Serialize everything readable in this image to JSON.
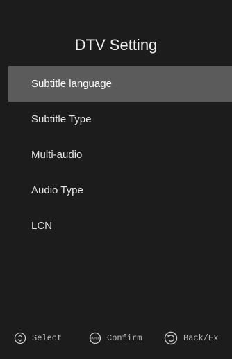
{
  "screen": {
    "title": "DTV Setting"
  },
  "menu": {
    "items": [
      {
        "label": "Subtitle language",
        "selected": true
      },
      {
        "label": "Subtitle Type",
        "selected": false
      },
      {
        "label": "Multi-audio",
        "selected": false
      },
      {
        "label": "Audio Type",
        "selected": false
      },
      {
        "label": "LCN",
        "selected": false
      }
    ]
  },
  "footer": {
    "select_label": "Select",
    "select_icon": "updown-icon",
    "confirm_label": "Confirm",
    "confirm_icon": "enter-icon",
    "confirm_icon_text": "ENTER",
    "back_label": "Back/Ex",
    "back_icon": "back-icon"
  },
  "colors": {
    "background": "#1c1c1c",
    "highlight": "#5b5b5b",
    "text": "#e6e6e6",
    "hint_text": "#bdbdbd"
  }
}
